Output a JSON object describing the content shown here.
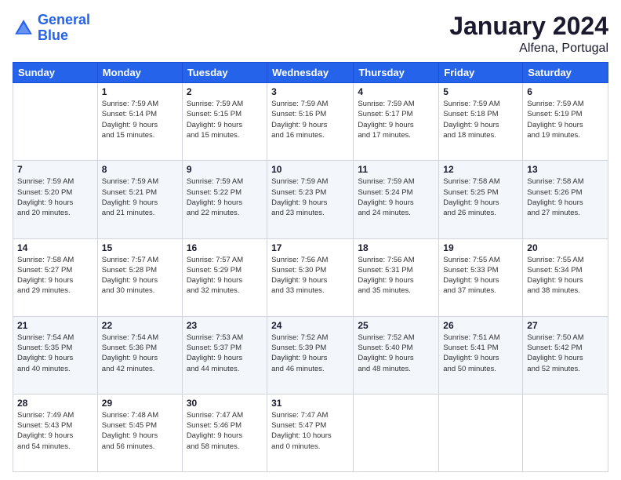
{
  "header": {
    "logo_line1": "General",
    "logo_line2": "Blue",
    "month_title": "January 2024",
    "location": "Alfena, Portugal"
  },
  "days_of_week": [
    "Sunday",
    "Monday",
    "Tuesday",
    "Wednesday",
    "Thursday",
    "Friday",
    "Saturday"
  ],
  "weeks": [
    [
      {
        "day": "",
        "info": ""
      },
      {
        "day": "1",
        "info": "Sunrise: 7:59 AM\nSunset: 5:14 PM\nDaylight: 9 hours\nand 15 minutes."
      },
      {
        "day": "2",
        "info": "Sunrise: 7:59 AM\nSunset: 5:15 PM\nDaylight: 9 hours\nand 15 minutes."
      },
      {
        "day": "3",
        "info": "Sunrise: 7:59 AM\nSunset: 5:16 PM\nDaylight: 9 hours\nand 16 minutes."
      },
      {
        "day": "4",
        "info": "Sunrise: 7:59 AM\nSunset: 5:17 PM\nDaylight: 9 hours\nand 17 minutes."
      },
      {
        "day": "5",
        "info": "Sunrise: 7:59 AM\nSunset: 5:18 PM\nDaylight: 9 hours\nand 18 minutes."
      },
      {
        "day": "6",
        "info": "Sunrise: 7:59 AM\nSunset: 5:19 PM\nDaylight: 9 hours\nand 19 minutes."
      }
    ],
    [
      {
        "day": "7",
        "info": "Sunrise: 7:59 AM\nSunset: 5:20 PM\nDaylight: 9 hours\nand 20 minutes."
      },
      {
        "day": "8",
        "info": "Sunrise: 7:59 AM\nSunset: 5:21 PM\nDaylight: 9 hours\nand 21 minutes."
      },
      {
        "day": "9",
        "info": "Sunrise: 7:59 AM\nSunset: 5:22 PM\nDaylight: 9 hours\nand 22 minutes."
      },
      {
        "day": "10",
        "info": "Sunrise: 7:59 AM\nSunset: 5:23 PM\nDaylight: 9 hours\nand 23 minutes."
      },
      {
        "day": "11",
        "info": "Sunrise: 7:59 AM\nSunset: 5:24 PM\nDaylight: 9 hours\nand 24 minutes."
      },
      {
        "day": "12",
        "info": "Sunrise: 7:58 AM\nSunset: 5:25 PM\nDaylight: 9 hours\nand 26 minutes."
      },
      {
        "day": "13",
        "info": "Sunrise: 7:58 AM\nSunset: 5:26 PM\nDaylight: 9 hours\nand 27 minutes."
      }
    ],
    [
      {
        "day": "14",
        "info": "Sunrise: 7:58 AM\nSunset: 5:27 PM\nDaylight: 9 hours\nand 29 minutes."
      },
      {
        "day": "15",
        "info": "Sunrise: 7:57 AM\nSunset: 5:28 PM\nDaylight: 9 hours\nand 30 minutes."
      },
      {
        "day": "16",
        "info": "Sunrise: 7:57 AM\nSunset: 5:29 PM\nDaylight: 9 hours\nand 32 minutes."
      },
      {
        "day": "17",
        "info": "Sunrise: 7:56 AM\nSunset: 5:30 PM\nDaylight: 9 hours\nand 33 minutes."
      },
      {
        "day": "18",
        "info": "Sunrise: 7:56 AM\nSunset: 5:31 PM\nDaylight: 9 hours\nand 35 minutes."
      },
      {
        "day": "19",
        "info": "Sunrise: 7:55 AM\nSunset: 5:33 PM\nDaylight: 9 hours\nand 37 minutes."
      },
      {
        "day": "20",
        "info": "Sunrise: 7:55 AM\nSunset: 5:34 PM\nDaylight: 9 hours\nand 38 minutes."
      }
    ],
    [
      {
        "day": "21",
        "info": "Sunrise: 7:54 AM\nSunset: 5:35 PM\nDaylight: 9 hours\nand 40 minutes."
      },
      {
        "day": "22",
        "info": "Sunrise: 7:54 AM\nSunset: 5:36 PM\nDaylight: 9 hours\nand 42 minutes."
      },
      {
        "day": "23",
        "info": "Sunrise: 7:53 AM\nSunset: 5:37 PM\nDaylight: 9 hours\nand 44 minutes."
      },
      {
        "day": "24",
        "info": "Sunrise: 7:52 AM\nSunset: 5:39 PM\nDaylight: 9 hours\nand 46 minutes."
      },
      {
        "day": "25",
        "info": "Sunrise: 7:52 AM\nSunset: 5:40 PM\nDaylight: 9 hours\nand 48 minutes."
      },
      {
        "day": "26",
        "info": "Sunrise: 7:51 AM\nSunset: 5:41 PM\nDaylight: 9 hours\nand 50 minutes."
      },
      {
        "day": "27",
        "info": "Sunrise: 7:50 AM\nSunset: 5:42 PM\nDaylight: 9 hours\nand 52 minutes."
      }
    ],
    [
      {
        "day": "28",
        "info": "Sunrise: 7:49 AM\nSunset: 5:43 PM\nDaylight: 9 hours\nand 54 minutes."
      },
      {
        "day": "29",
        "info": "Sunrise: 7:48 AM\nSunset: 5:45 PM\nDaylight: 9 hours\nand 56 minutes."
      },
      {
        "day": "30",
        "info": "Sunrise: 7:47 AM\nSunset: 5:46 PM\nDaylight: 9 hours\nand 58 minutes."
      },
      {
        "day": "31",
        "info": "Sunrise: 7:47 AM\nSunset: 5:47 PM\nDaylight: 10 hours\nand 0 minutes."
      },
      {
        "day": "",
        "info": ""
      },
      {
        "day": "",
        "info": ""
      },
      {
        "day": "",
        "info": ""
      }
    ]
  ]
}
